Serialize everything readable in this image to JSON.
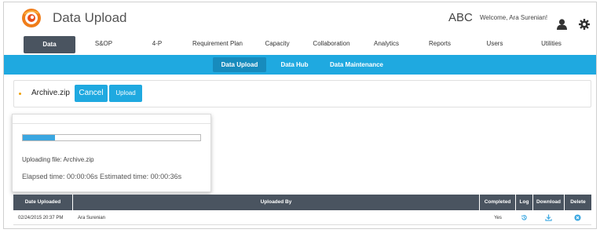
{
  "header": {
    "app_title": "Data Upload",
    "tenant": "ABC",
    "welcome": "Welcome, Ara Surenian!",
    "brand_color": "#f07d1a"
  },
  "main_nav": {
    "items": [
      "Data",
      "S&OP",
      "4-P",
      "Requirement Plan",
      "Capacity",
      "Collaboration",
      "Analytics",
      "Reports",
      "Users",
      "Utilities"
    ],
    "active": "Data"
  },
  "sub_nav": {
    "items": [
      "Data Upload",
      "Data Hub",
      "Data Maintenance"
    ],
    "active": "Data Upload",
    "color": "#1fa9e0"
  },
  "upload": {
    "filename": "Archive.zip",
    "cancel_label": "Cancel",
    "upload_label": "Upload"
  },
  "progress": {
    "fraction": 0.18,
    "file_text": "Uploading file: Archive.zip",
    "time_text": "Elapsed time: 00:00:06s Estimated time: 00:00:36s"
  },
  "table": {
    "headers": [
      "Date Uploaded",
      "Uploaded By",
      "Completed",
      "Log",
      "Download",
      "Delete"
    ],
    "rows": [
      {
        "date": "02/24/2015 20:37 PM",
        "user": "Ara Surenian",
        "completed": "Yes",
        "log_icon": "history-icon",
        "download_icon": "download-icon",
        "delete_icon": "delete-icon"
      }
    ]
  }
}
